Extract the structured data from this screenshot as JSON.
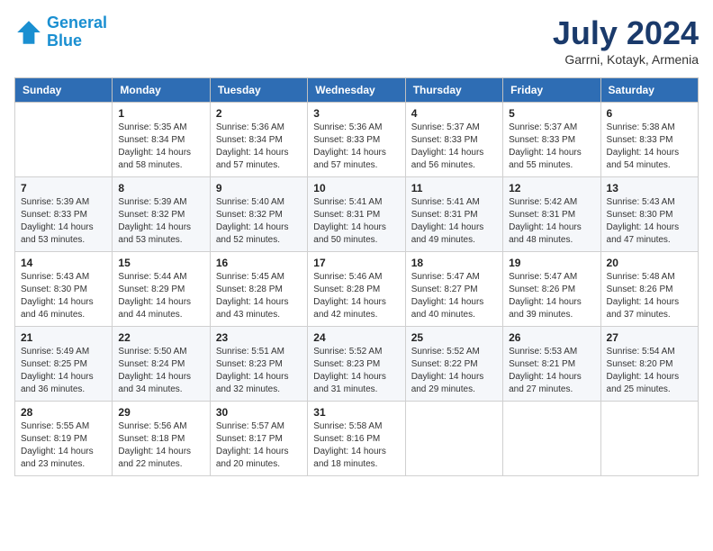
{
  "header": {
    "logo_line1": "General",
    "logo_line2": "Blue",
    "month": "July 2024",
    "location": "Garrni, Kotayk, Armenia"
  },
  "weekdays": [
    "Sunday",
    "Monday",
    "Tuesday",
    "Wednesday",
    "Thursday",
    "Friday",
    "Saturday"
  ],
  "weeks": [
    [
      {
        "day": "",
        "info": ""
      },
      {
        "day": "1",
        "info": "Sunrise: 5:35 AM\nSunset: 8:34 PM\nDaylight: 14 hours\nand 58 minutes."
      },
      {
        "day": "2",
        "info": "Sunrise: 5:36 AM\nSunset: 8:34 PM\nDaylight: 14 hours\nand 57 minutes."
      },
      {
        "day": "3",
        "info": "Sunrise: 5:36 AM\nSunset: 8:33 PM\nDaylight: 14 hours\nand 57 minutes."
      },
      {
        "day": "4",
        "info": "Sunrise: 5:37 AM\nSunset: 8:33 PM\nDaylight: 14 hours\nand 56 minutes."
      },
      {
        "day": "5",
        "info": "Sunrise: 5:37 AM\nSunset: 8:33 PM\nDaylight: 14 hours\nand 55 minutes."
      },
      {
        "day": "6",
        "info": "Sunrise: 5:38 AM\nSunset: 8:33 PM\nDaylight: 14 hours\nand 54 minutes."
      }
    ],
    [
      {
        "day": "7",
        "info": "Sunrise: 5:39 AM\nSunset: 8:33 PM\nDaylight: 14 hours\nand 53 minutes."
      },
      {
        "day": "8",
        "info": "Sunrise: 5:39 AM\nSunset: 8:32 PM\nDaylight: 14 hours\nand 53 minutes."
      },
      {
        "day": "9",
        "info": "Sunrise: 5:40 AM\nSunset: 8:32 PM\nDaylight: 14 hours\nand 52 minutes."
      },
      {
        "day": "10",
        "info": "Sunrise: 5:41 AM\nSunset: 8:31 PM\nDaylight: 14 hours\nand 50 minutes."
      },
      {
        "day": "11",
        "info": "Sunrise: 5:41 AM\nSunset: 8:31 PM\nDaylight: 14 hours\nand 49 minutes."
      },
      {
        "day": "12",
        "info": "Sunrise: 5:42 AM\nSunset: 8:31 PM\nDaylight: 14 hours\nand 48 minutes."
      },
      {
        "day": "13",
        "info": "Sunrise: 5:43 AM\nSunset: 8:30 PM\nDaylight: 14 hours\nand 47 minutes."
      }
    ],
    [
      {
        "day": "14",
        "info": "Sunrise: 5:43 AM\nSunset: 8:30 PM\nDaylight: 14 hours\nand 46 minutes."
      },
      {
        "day": "15",
        "info": "Sunrise: 5:44 AM\nSunset: 8:29 PM\nDaylight: 14 hours\nand 44 minutes."
      },
      {
        "day": "16",
        "info": "Sunrise: 5:45 AM\nSunset: 8:28 PM\nDaylight: 14 hours\nand 43 minutes."
      },
      {
        "day": "17",
        "info": "Sunrise: 5:46 AM\nSunset: 8:28 PM\nDaylight: 14 hours\nand 42 minutes."
      },
      {
        "day": "18",
        "info": "Sunrise: 5:47 AM\nSunset: 8:27 PM\nDaylight: 14 hours\nand 40 minutes."
      },
      {
        "day": "19",
        "info": "Sunrise: 5:47 AM\nSunset: 8:26 PM\nDaylight: 14 hours\nand 39 minutes."
      },
      {
        "day": "20",
        "info": "Sunrise: 5:48 AM\nSunset: 8:26 PM\nDaylight: 14 hours\nand 37 minutes."
      }
    ],
    [
      {
        "day": "21",
        "info": "Sunrise: 5:49 AM\nSunset: 8:25 PM\nDaylight: 14 hours\nand 36 minutes."
      },
      {
        "day": "22",
        "info": "Sunrise: 5:50 AM\nSunset: 8:24 PM\nDaylight: 14 hours\nand 34 minutes."
      },
      {
        "day": "23",
        "info": "Sunrise: 5:51 AM\nSunset: 8:23 PM\nDaylight: 14 hours\nand 32 minutes."
      },
      {
        "day": "24",
        "info": "Sunrise: 5:52 AM\nSunset: 8:23 PM\nDaylight: 14 hours\nand 31 minutes."
      },
      {
        "day": "25",
        "info": "Sunrise: 5:52 AM\nSunset: 8:22 PM\nDaylight: 14 hours\nand 29 minutes."
      },
      {
        "day": "26",
        "info": "Sunrise: 5:53 AM\nSunset: 8:21 PM\nDaylight: 14 hours\nand 27 minutes."
      },
      {
        "day": "27",
        "info": "Sunrise: 5:54 AM\nSunset: 8:20 PM\nDaylight: 14 hours\nand 25 minutes."
      }
    ],
    [
      {
        "day": "28",
        "info": "Sunrise: 5:55 AM\nSunset: 8:19 PM\nDaylight: 14 hours\nand 23 minutes."
      },
      {
        "day": "29",
        "info": "Sunrise: 5:56 AM\nSunset: 8:18 PM\nDaylight: 14 hours\nand 22 minutes."
      },
      {
        "day": "30",
        "info": "Sunrise: 5:57 AM\nSunset: 8:17 PM\nDaylight: 14 hours\nand 20 minutes."
      },
      {
        "day": "31",
        "info": "Sunrise: 5:58 AM\nSunset: 8:16 PM\nDaylight: 14 hours\nand 18 minutes."
      },
      {
        "day": "",
        "info": ""
      },
      {
        "day": "",
        "info": ""
      },
      {
        "day": "",
        "info": ""
      }
    ]
  ]
}
